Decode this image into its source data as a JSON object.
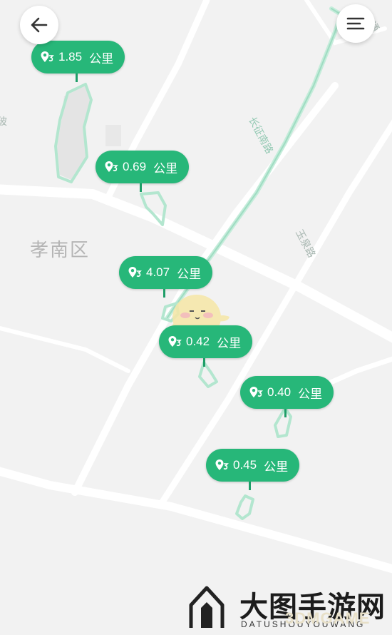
{
  "map": {
    "district_label": "孝南区",
    "road_label_1": "长征南路",
    "road_label_2": "玉泉路",
    "road_label_3": "通",
    "road_label_4": "玻"
  },
  "controls": {
    "back_icon": "arrow-left-icon",
    "menu_icon": "menu-icon"
  },
  "markers": [
    {
      "distance": "1.85",
      "unit": "公里"
    },
    {
      "distance": "0.69",
      "unit": "公里"
    },
    {
      "distance": "4.07",
      "unit": "公里"
    },
    {
      "distance": "0.42",
      "unit": "公里"
    },
    {
      "distance": "0.40",
      "unit": "公里"
    },
    {
      "distance": "0.45",
      "unit": "公里"
    }
  ],
  "watermark": {
    "title": "大图手游网",
    "subtitle": "DATUSHOUYOUWANG",
    "brand": "3DMGAME"
  },
  "colors": {
    "marker": "#27b779",
    "route": "#a8e3cb",
    "map_bg": "#f2f2f2"
  }
}
